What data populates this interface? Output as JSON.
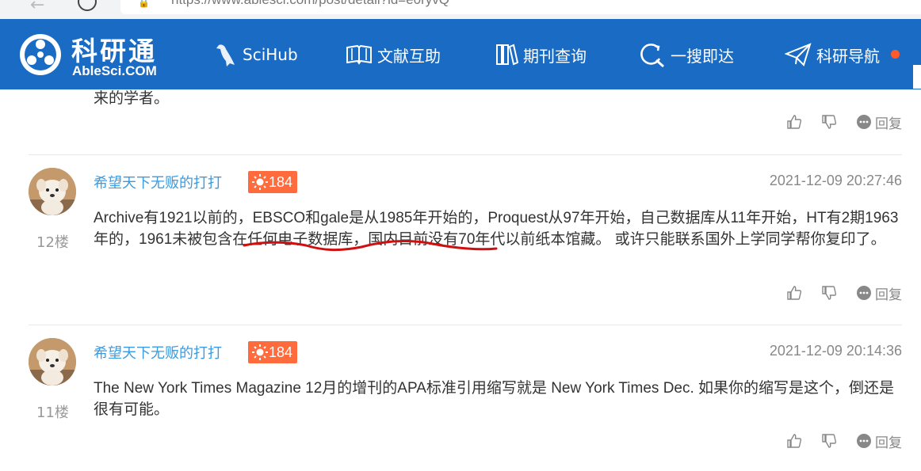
{
  "browser": {
    "url": "https://www.ablesci.com/post/detail?id=e0ryvQ"
  },
  "header": {
    "logo_cn": "科研通",
    "logo_en": "AbleSci.COM",
    "brand_color": "#1a6bc3",
    "nav": [
      {
        "label": "SciHub",
        "icon": "bird-icon"
      },
      {
        "label": "文献互助",
        "icon": "open-book-icon"
      },
      {
        "label": "期刊查询",
        "icon": "books-icon"
      },
      {
        "label": "一搜即达",
        "icon": "search-refresh-icon"
      },
      {
        "label": "科研导航",
        "icon": "paper-plane-icon"
      }
    ],
    "nav_dot_color": "#ff5a2a"
  },
  "previous_post": {
    "text_tail": "来的学者。",
    "reply_label": "回复"
  },
  "posts": [
    {
      "floor": "12楼",
      "username": "希望天下无贩的打打",
      "badge_value": "184",
      "time": "2021-12-09 20:27:46",
      "content": "Archive有1921以前的，EBSCO和gale是从1985年开始的，Proquest从97年开始，自己数据库从11年开始，HT有2期1963年的，1961未被包含在任何电子数据库，国内目前没有70年代以前纸本馆藏。 或许只能联系国外上学同学帮你复印了。",
      "reply_label": "回复"
    },
    {
      "floor": "11楼",
      "username": "希望天下无贩的打打",
      "badge_value": "184",
      "time": "2021-12-09 20:14:36",
      "content": "The New York Times Magazine 12月的增刊的APA标准引用缩写就是 New York Times Dec. 如果你的缩写是这个，倒还是很有可能。",
      "reply_label": "回复"
    }
  ],
  "colors": {
    "username": "#3c9be0",
    "badge": "#ff6b3d",
    "annotation_underline": "#d01010"
  }
}
